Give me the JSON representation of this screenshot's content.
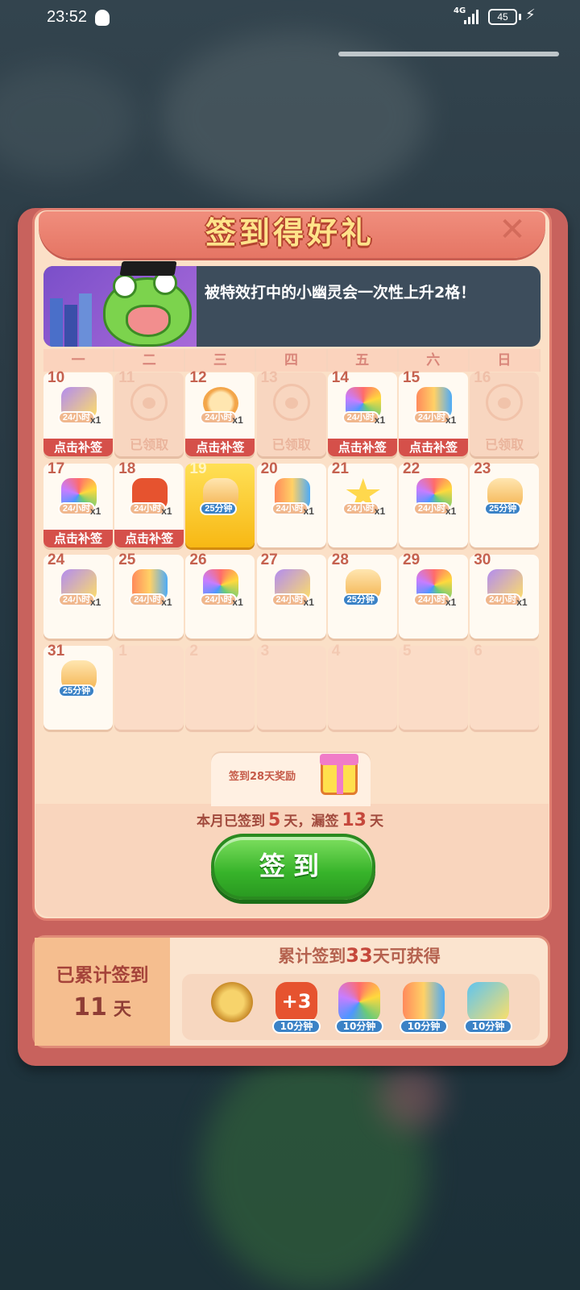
{
  "status": {
    "time": "23:52",
    "network": "4G",
    "battery": "45"
  },
  "popup": {
    "title": "签到得好礼",
    "banner_text": "被特效打中的小幽灵会一次性上升2格！",
    "weekdays": [
      "一",
      "二",
      "三",
      "四",
      "五",
      "六",
      "日"
    ],
    "claim_label": "点击补签",
    "claimed_label": "已领取",
    "days": [
      {
        "n": "10",
        "state": "missed",
        "item": "chick",
        "badge": "24小时",
        "qty": "x1"
      },
      {
        "n": "11",
        "state": "claimed"
      },
      {
        "n": "12",
        "state": "missed",
        "item": "clock",
        "badge": "24小时",
        "qty": "x1"
      },
      {
        "n": "13",
        "state": "claimed"
      },
      {
        "n": "14",
        "state": "missed",
        "item": "owl",
        "badge": "24小时",
        "qty": "x1"
      },
      {
        "n": "15",
        "state": "missed",
        "item": "rocket",
        "badge": "24小时",
        "qty": "x1"
      },
      {
        "n": "16",
        "state": "claimed"
      },
      {
        "n": "17",
        "state": "missed",
        "item": "owl",
        "badge": "24小时",
        "qty": "x1"
      },
      {
        "n": "18",
        "state": "missed",
        "item": "plus3",
        "badge": "24小时",
        "qty": "x1"
      },
      {
        "n": "19",
        "state": "today",
        "item": "bottle",
        "badge": "25分钟",
        "qty": ""
      },
      {
        "n": "20",
        "state": "future",
        "item": "rocket",
        "badge": "24小时",
        "qty": "x1"
      },
      {
        "n": "21",
        "state": "future",
        "item": "star",
        "badge": "24小时",
        "qty": "x1"
      },
      {
        "n": "22",
        "state": "future",
        "item": "owl",
        "badge": "24小时",
        "qty": "x1"
      },
      {
        "n": "23",
        "state": "future",
        "item": "bottle",
        "badge": "25分钟",
        "qty": ""
      },
      {
        "n": "24",
        "state": "future",
        "item": "chick",
        "badge": "24小时",
        "qty": "x1"
      },
      {
        "n": "25",
        "state": "future",
        "item": "rocket",
        "badge": "24小时",
        "qty": "x1"
      },
      {
        "n": "26",
        "state": "future",
        "item": "owl",
        "badge": "24小时",
        "qty": "x1"
      },
      {
        "n": "27",
        "state": "future",
        "item": "chick",
        "badge": "24小时",
        "qty": "x1"
      },
      {
        "n": "28",
        "state": "future",
        "item": "bottle",
        "badge": "25分钟",
        "qty": ""
      },
      {
        "n": "29",
        "state": "future",
        "item": "owl",
        "badge": "24小时",
        "qty": "x1"
      },
      {
        "n": "30",
        "state": "future",
        "item": "chick",
        "badge": "24小时",
        "qty": "x1"
      },
      {
        "n": "31",
        "state": "future",
        "item": "bottle",
        "badge": "25分钟",
        "qty": ""
      },
      {
        "n": "1",
        "state": "empty"
      },
      {
        "n": "2",
        "state": "empty"
      },
      {
        "n": "3",
        "state": "empty"
      },
      {
        "n": "4",
        "state": "empty"
      },
      {
        "n": "5",
        "state": "empty"
      },
      {
        "n": "6",
        "state": "empty"
      }
    ],
    "gift_tab_label": "签到28天奖励",
    "month_stat": {
      "prefix": "本月已签到",
      "signed": "5",
      "mid": "天，漏签",
      "missed": "13",
      "suffix": "天"
    },
    "sign_button": "签到",
    "accum": {
      "label": "已累计签到",
      "days": "11",
      "days_unit": "天",
      "title_prefix": "累计签到",
      "target": "33",
      "title_suffix": "天可获得",
      "rewards": [
        {
          "icon": "medal-icon",
          "label": ""
        },
        {
          "icon": "plus3-icon",
          "label": "10分钟"
        },
        {
          "icon": "owl-icon",
          "label": "10分钟"
        },
        {
          "icon": "rocket-icon",
          "label": "10分钟"
        },
        {
          "icon": "chick-icon",
          "label": "10分钟"
        }
      ]
    }
  },
  "colors": {
    "panel": "#c8625d",
    "cream": "#fbe0c7",
    "red_button": "#d5504a",
    "green_button": "#37b32a",
    "gold": "#ffe38a"
  }
}
